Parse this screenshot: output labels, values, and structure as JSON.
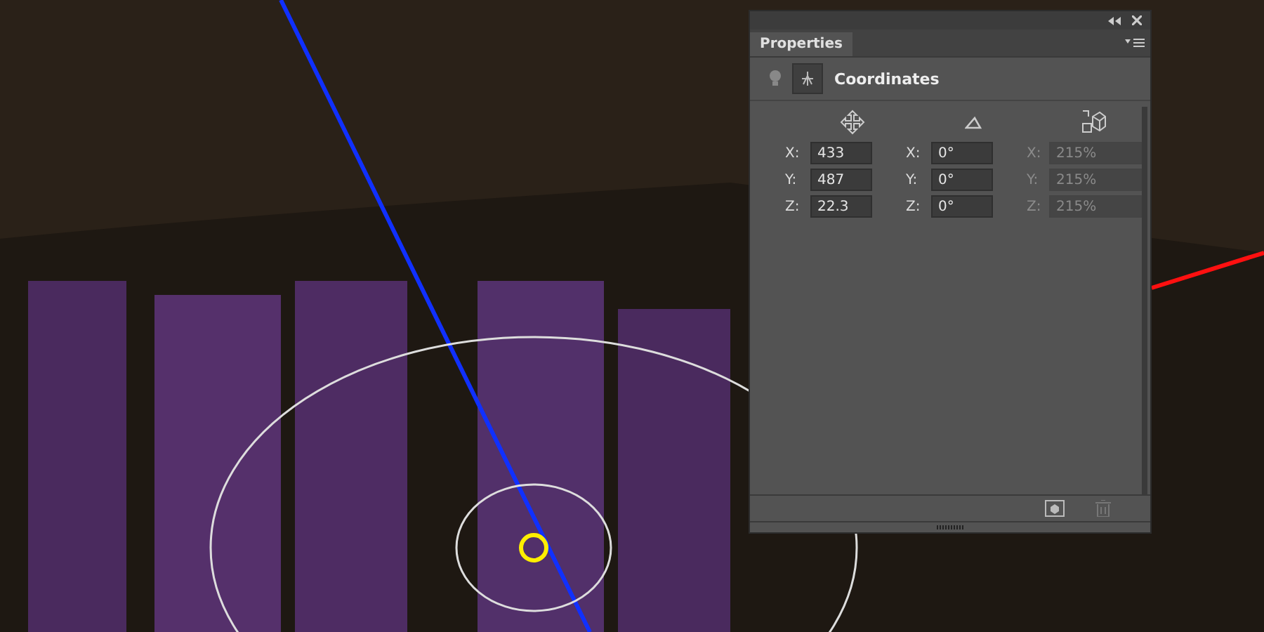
{
  "panel": {
    "tab": "Properties",
    "section_title": "Coordinates",
    "columns": [
      {
        "kind": "move",
        "disabled": false,
        "fields": [
          {
            "axis": "X:",
            "value": "433"
          },
          {
            "axis": "Y:",
            "value": "487"
          },
          {
            "axis": "Z:",
            "value": "22.3"
          }
        ]
      },
      {
        "kind": "rotate",
        "disabled": false,
        "fields": [
          {
            "axis": "X:",
            "value": "0°"
          },
          {
            "axis": "Y:",
            "value": "0°"
          },
          {
            "axis": "Z:",
            "value": "0°"
          }
        ]
      },
      {
        "kind": "scale",
        "disabled": true,
        "fields": [
          {
            "axis": "X:",
            "value": "215%"
          },
          {
            "axis": "Y:",
            "value": "215%"
          },
          {
            "axis": "Z:",
            "value": "215%"
          }
        ]
      }
    ]
  }
}
